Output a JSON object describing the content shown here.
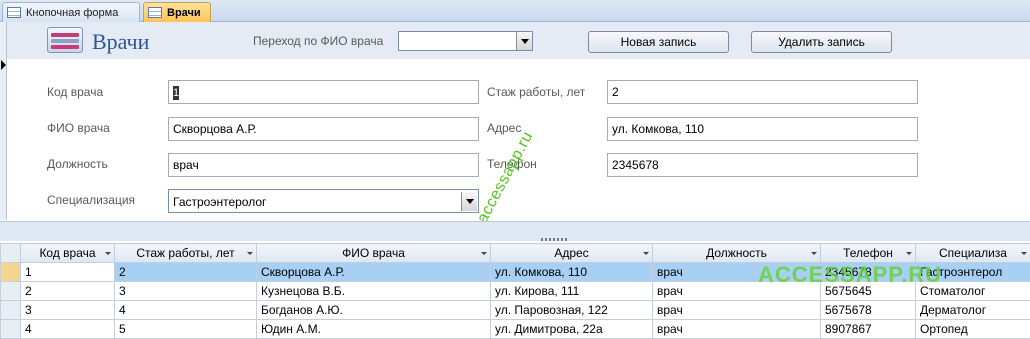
{
  "tabs": [
    {
      "label": "Кнопочная форма",
      "icon": "form-icon"
    },
    {
      "label": "Врачи",
      "icon": "form-icon"
    }
  ],
  "header": {
    "title": "Врачи",
    "nav_label": "Переход по ФИО врача",
    "nav_value": "",
    "new_record": "Новая запись",
    "delete_record": "Удалить запись"
  },
  "fields": {
    "code_label": "Код врача",
    "code_value": "1",
    "name_label": "ФИО врача",
    "name_value": "Скворцова А.Р.",
    "position_label": "Должность",
    "position_value": "врач",
    "spec_label": "Специализация",
    "spec_value": "Гастроэнтеролог",
    "exp_label": "Стаж работы, лет",
    "exp_value": "2",
    "address_label": "Адрес",
    "address_value": "ул. Комкова, 110",
    "phone_label": "Телефон",
    "phone_value": "2345678"
  },
  "watermark": "accessapp.ru",
  "watermark2": "ACCESSAPP.RU",
  "grid": {
    "columns": [
      "Код врача",
      "Стаж работы, лет",
      "ФИО врача",
      "Адрес",
      "Должность",
      "Телефон",
      "Специализа"
    ],
    "rows": [
      [
        "1",
        "2",
        "Скворцова А.Р.",
        "ул. Комкова, 110",
        "врач",
        "2345678",
        "Гастроэнтерол"
      ],
      [
        "2",
        "3",
        "Кузнецова В.Б.",
        "ул. Кирова, 111",
        "врач",
        "5675645",
        "Стоматолог"
      ],
      [
        "3",
        "4",
        "Богданов А.Ю.",
        "ул. Паровозная, 122",
        "врач",
        "5675678",
        "Дерматолог"
      ],
      [
        "4",
        "5",
        "Юдин А.М.",
        "ул. Димитрова, 22а",
        "врач",
        "8907867",
        "Ортопед"
      ]
    ]
  }
}
